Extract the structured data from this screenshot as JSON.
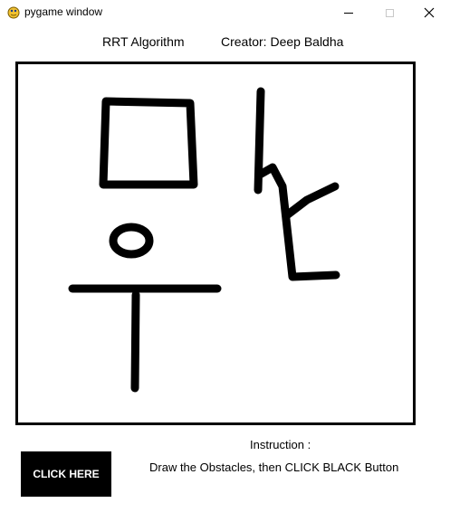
{
  "window": {
    "title": "pygame window",
    "icon": "pygame-snake-icon",
    "controls": {
      "minimize": "minimize-icon",
      "maximize": "maximize-icon",
      "close_glyph": "✕"
    }
  },
  "header": {
    "algorithm": "RRT Algorithm",
    "creator": "Creator: Deep Baldha"
  },
  "canvas": {
    "background": "#ffffff",
    "border_color": "#000000",
    "stroke_color": "#000000"
  },
  "controls": {
    "button_label": "CLICK HERE",
    "button_color": "#000000"
  },
  "instructions": {
    "title": "Instruction :",
    "text": "Draw the Obstacles, then CLICK BLACK Button"
  }
}
